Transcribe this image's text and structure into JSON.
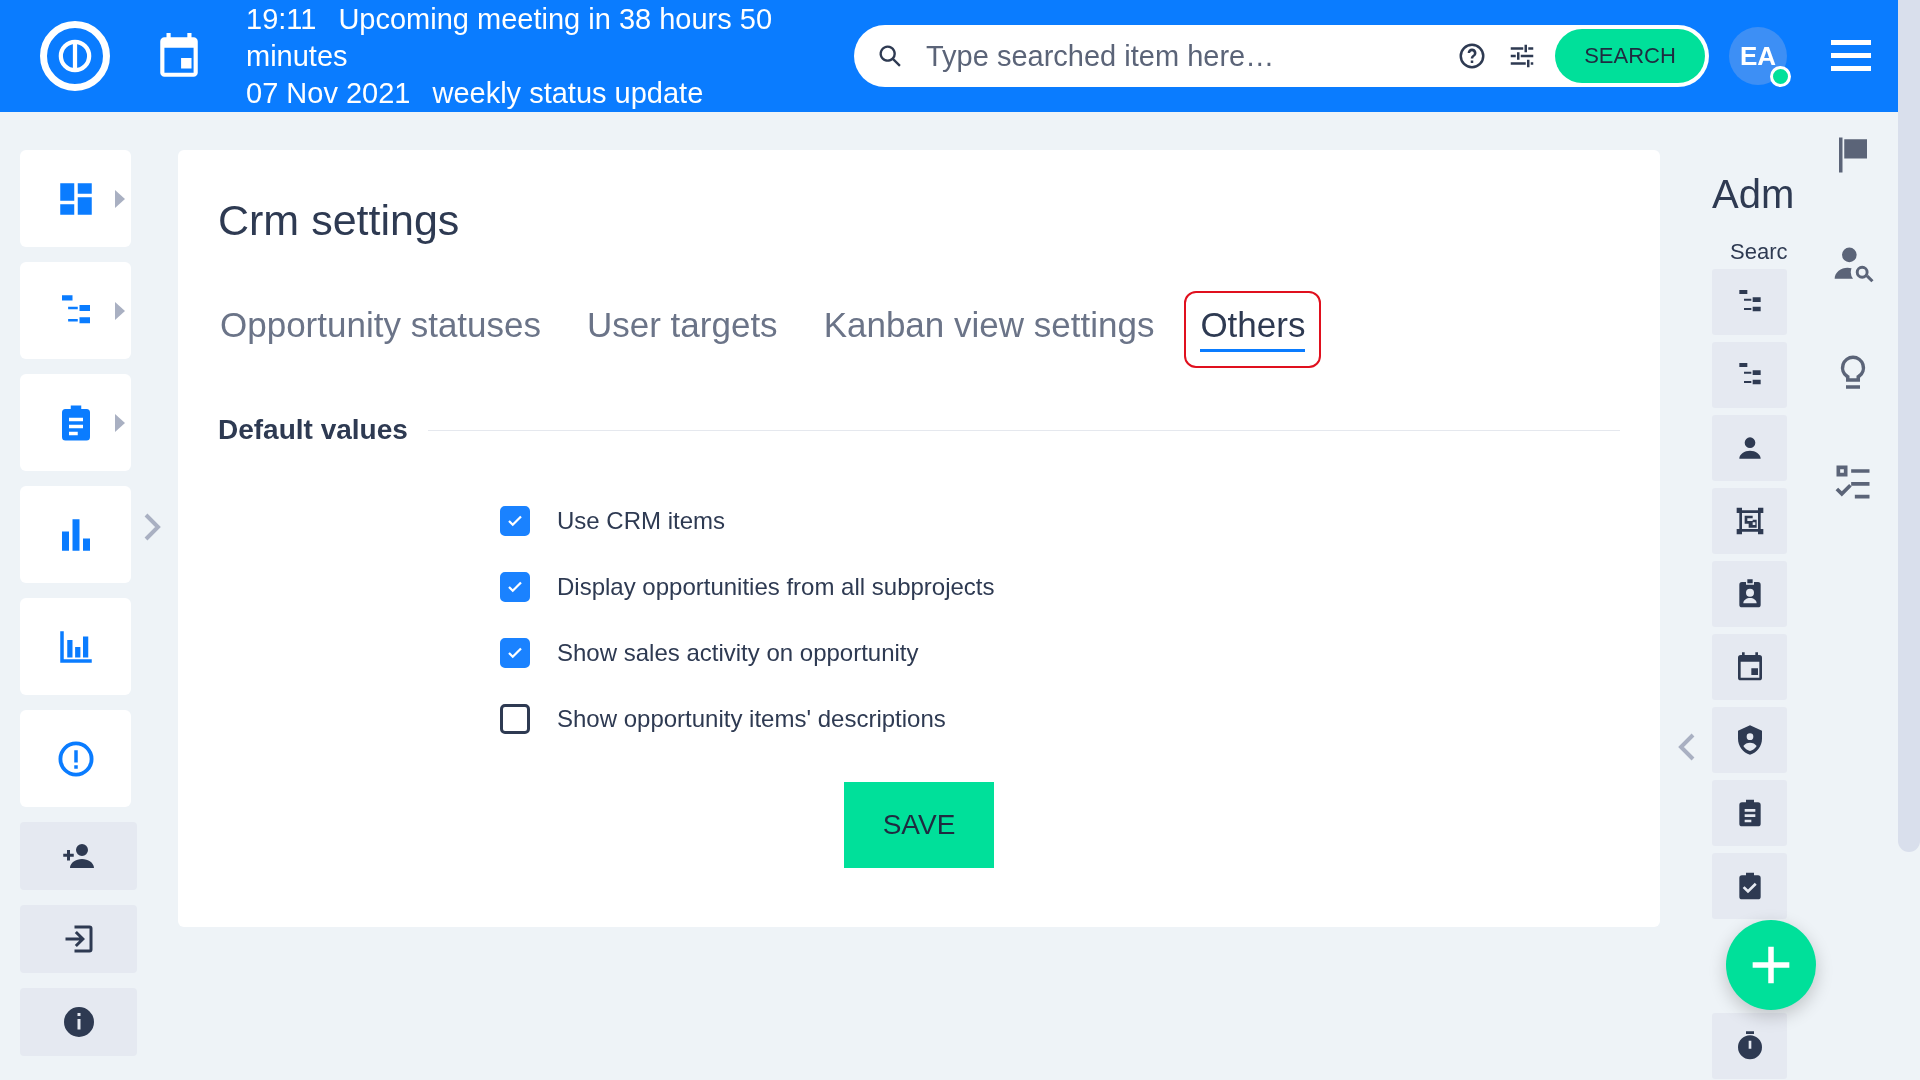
{
  "header": {
    "meeting_time": "19:11",
    "meeting_title": "Upcoming meeting in 38 hours 50 minutes",
    "meeting_date": "07 Nov 2021",
    "meeting_subject": "weekly status update",
    "search": {
      "placeholder": "Type searched item here…",
      "button": "SEARCH"
    },
    "avatar": {
      "initials": "EA",
      "online": true
    }
  },
  "page": {
    "title": "Crm settings",
    "tabs": [
      {
        "label": "Opportunity statuses",
        "selected": false,
        "highlighted": false
      },
      {
        "label": "User targets",
        "selected": false,
        "highlighted": false
      },
      {
        "label": "Kanban view settings",
        "selected": false,
        "highlighted": false
      },
      {
        "label": "Others",
        "selected": true,
        "highlighted": true
      }
    ],
    "section_title": "Default values",
    "options": [
      {
        "label": "Use CRM items",
        "checked": true
      },
      {
        "label": "Display opportunities from all subprojects",
        "checked": true
      },
      {
        "label": "Show sales activity on opportunity",
        "checked": true
      },
      {
        "label": "Show opportunity items' descriptions",
        "checked": false
      }
    ],
    "save_button": "SAVE"
  },
  "admin_panel": {
    "title": "Adm",
    "search_label": "Searc"
  }
}
